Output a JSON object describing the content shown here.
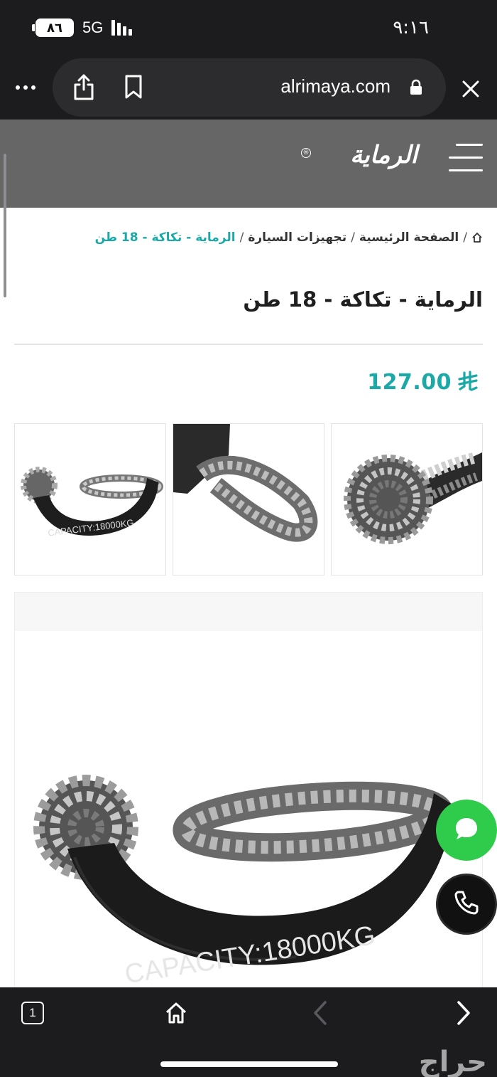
{
  "status_bar": {
    "battery": "٨٦",
    "network": "5G",
    "time": "٩:١٦"
  },
  "browser": {
    "url": "alrimaya.com",
    "icons": [
      "more-icon",
      "share-icon",
      "bookmark-icon",
      "lock-icon",
      "close-icon"
    ]
  },
  "header": {
    "logo_text": "الرماية",
    "logo_mark": "®",
    "bg_color": "#666666"
  },
  "breadcrumb": {
    "items": [
      "الصفحة الرئيسية",
      "تجهيزات السيارة"
    ],
    "separator": "/",
    "current": "الرماية - تكاكة - 18 طن"
  },
  "product": {
    "title": "الرماية - تكاكة - 18 طن",
    "price": "127.00",
    "currency_icon": "riyal-icon",
    "accent_color": "#1aa9a6",
    "image_label": "CAPACITY:18000KG",
    "thumbnails": [
      "shackle-knot-closeup",
      "shackle-loop-closeup",
      "shackle-full-view"
    ]
  },
  "floating_buttons": {
    "chat_color": "#2ecc4a",
    "phone_color": "#111111"
  },
  "bottom_bar": {
    "tab_count": "1",
    "watermark": "حراج"
  }
}
